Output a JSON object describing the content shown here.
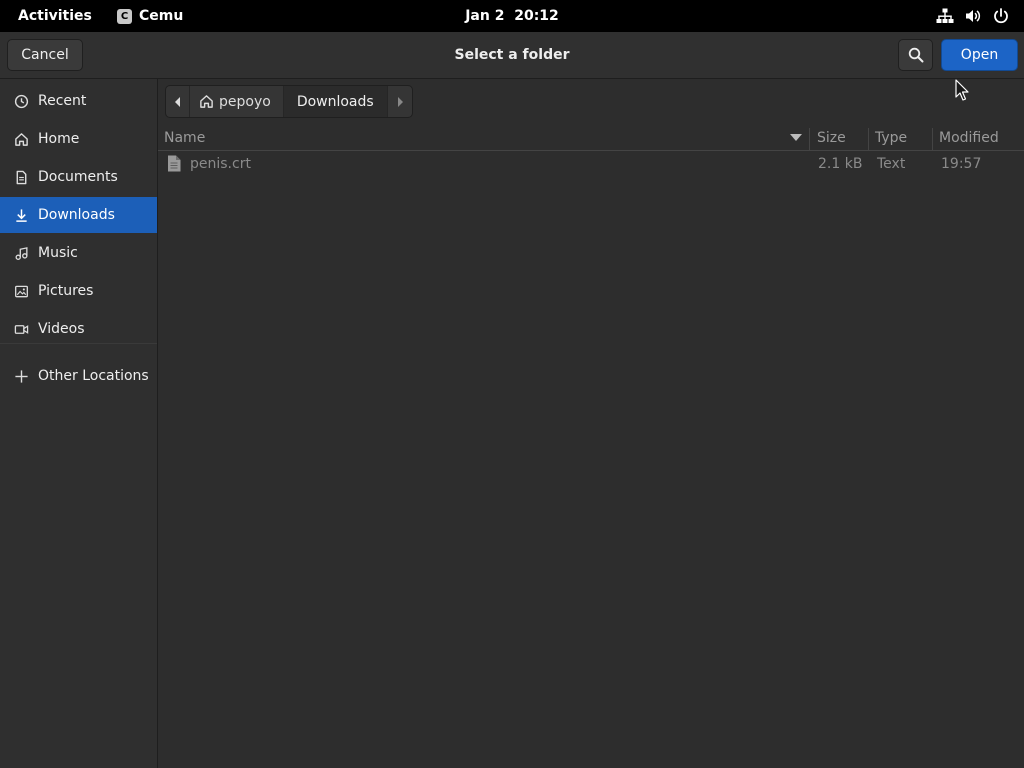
{
  "topbar": {
    "activities": "Activities",
    "app_name": "Cemu",
    "app_icon_letter": "C",
    "clock": "Jan 2  20:12",
    "tray_icons": [
      "network-icon",
      "volume-icon",
      "power-icon"
    ]
  },
  "dialog": {
    "title": "Select a folder",
    "cancel_label": "Cancel",
    "open_label": "Open",
    "accent_color": "#1c64c6"
  },
  "sidebar": {
    "items": [
      {
        "label": "Recent",
        "icon": "clock-icon"
      },
      {
        "label": "Home",
        "icon": "home-icon"
      },
      {
        "label": "Documents",
        "icon": "document-icon"
      },
      {
        "label": "Downloads",
        "icon": "download-icon",
        "active": true
      },
      {
        "label": "Music",
        "icon": "music-icon"
      },
      {
        "label": "Pictures",
        "icon": "picture-icon"
      },
      {
        "label": "Videos",
        "icon": "video-icon"
      },
      {
        "label": "Other Locations",
        "icon": "plus-icon"
      }
    ]
  },
  "pathbar": {
    "home_label": "pepoyo",
    "current_label": "Downloads"
  },
  "filelist": {
    "columns": {
      "name": "Name",
      "size": "Size",
      "type": "Type",
      "modified": "Modified"
    },
    "rows": [
      {
        "name": "penis.crt",
        "size": "2.1 kB",
        "type": "Text",
        "modified": "19:57"
      }
    ]
  }
}
